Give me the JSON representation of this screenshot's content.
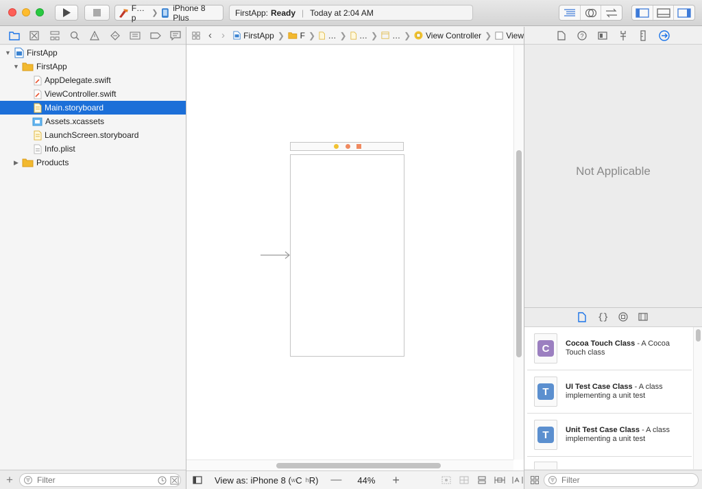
{
  "toolbar": {
    "scheme_target": "F…p",
    "scheme_device": "iPhone 8 Plus",
    "status_app": "FirstApp:",
    "status_state": "Ready",
    "status_time": "Today at 2:04 AM"
  },
  "navigator": {
    "items": [
      {
        "label": "FirstApp"
      },
      {
        "label": "FirstApp"
      },
      {
        "label": "AppDelegate.swift"
      },
      {
        "label": "ViewController.swift"
      },
      {
        "label": "Main.storyboard"
      },
      {
        "label": "Assets.xcassets"
      },
      {
        "label": "LaunchScreen.storyboard"
      },
      {
        "label": "Info.plist"
      },
      {
        "label": "Products"
      }
    ],
    "filter_placeholder": "Filter"
  },
  "jumpbar": {
    "crumbs": [
      "FirstApp",
      "F",
      "…",
      "…",
      "…",
      "View Controller",
      "View"
    ]
  },
  "editor": {
    "view_as_label": "View as: iPhone 8 (",
    "size_class_w": "w",
    "size_class_c": "C",
    "size_class_h": "h",
    "size_class_r": "R)",
    "zoom": "44%"
  },
  "inspector": {
    "empty_text": "Not Applicable"
  },
  "library": {
    "templates": [
      {
        "title": "Cocoa Touch Class",
        "desc_1": " - A Cocoa",
        "desc_2": "Touch class",
        "letter": "C",
        "color": "#9b7fc0"
      },
      {
        "title": "UI Test Case Class",
        "desc_1": " - A class",
        "desc_2": "implementing a unit test",
        "letter": "T",
        "color": "#5b8fcf"
      },
      {
        "title": "Unit Test Case Class",
        "desc_1": " - A class",
        "desc_2": "implementing a unit test",
        "letter": "T",
        "color": "#5b8fcf"
      }
    ],
    "filter_placeholder": "Filter"
  },
  "colors": {
    "selection": "#1c6fd8",
    "accent": "#1a73e8",
    "folder": "#f2b92f"
  }
}
